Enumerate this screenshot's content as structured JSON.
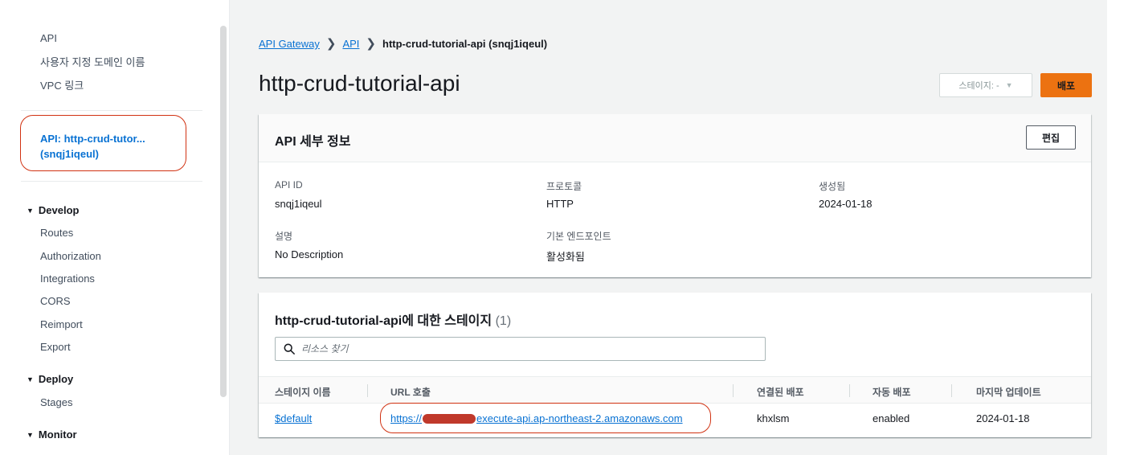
{
  "sidebar": {
    "top_links": [
      "API",
      "사용자 지정 도메인 이름",
      "VPC 링크"
    ],
    "active_api": {
      "line1": "API: http-crud-tutor...",
      "line2": "(snqj1iqeul)"
    },
    "sections": [
      {
        "title": "Develop",
        "items": [
          "Routes",
          "Authorization",
          "Integrations",
          "CORS",
          "Reimport",
          "Export"
        ]
      },
      {
        "title": "Deploy",
        "items": [
          "Stages"
        ]
      },
      {
        "title": "Monitor",
        "items": []
      }
    ]
  },
  "breadcrumb": {
    "root": "API Gateway",
    "mid": "API",
    "current": "http-crud-tutorial-api (snqj1iqeul)"
  },
  "header": {
    "title": "http-crud-tutorial-api",
    "stage_select": "스테이지: -",
    "deploy_label": "배포"
  },
  "details": {
    "title": "API 세부 정보",
    "edit_label": "편집",
    "fields": [
      {
        "label": "API ID",
        "value": "snqj1iqeul"
      },
      {
        "label": "프로토콜",
        "value": "HTTP"
      },
      {
        "label": "생성됨",
        "value": "2024-01-18"
      },
      {
        "label": "설명",
        "value": "No Description"
      },
      {
        "label": "기본 엔드포인트",
        "value": "활성화됨"
      }
    ]
  },
  "stages": {
    "title": "http-crud-tutorial-api에 대한 스테이지",
    "count": "(1)",
    "search_placeholder": "리소스 찾기",
    "columns": [
      "스테이지 이름",
      "URL 호출",
      "연결된 배포",
      "자동 배포",
      "마지막 업데이트"
    ],
    "rows": [
      {
        "stage": "$default",
        "url_prefix": "https://",
        "url_suffix": "execute-api.ap-northeast-2.amazonaws.com",
        "deployment": "khxlsm",
        "auto_deploy": "enabled",
        "updated": "2024-01-18"
      }
    ]
  },
  "colors": {
    "accent": "#0972d3",
    "deploy": "#ec7211",
    "highlight": "#d13212"
  }
}
